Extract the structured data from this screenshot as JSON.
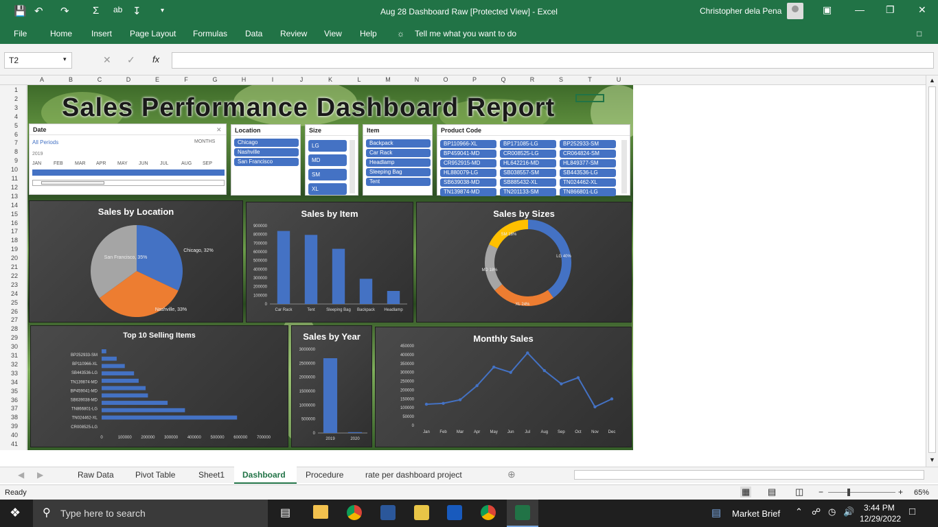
{
  "window": {
    "title": "Aug 28 Dashboard Raw  [Protected View]  -  Excel",
    "user": "Christopher dela Pena"
  },
  "ribbon": {
    "tabs": [
      "File",
      "Home",
      "Insert",
      "Page Layout",
      "Formulas",
      "Data",
      "Review",
      "View",
      "Help"
    ],
    "tell_me": "Tell me what you want to do"
  },
  "formula_bar": {
    "name_box": "T2",
    "fx": "fx",
    "formula": ""
  },
  "columns": [
    "A",
    "B",
    "C",
    "D",
    "E",
    "F",
    "G",
    "H",
    "I",
    "J",
    "K",
    "L",
    "M",
    "N",
    "O",
    "P",
    "Q",
    "R",
    "S",
    "T",
    "U"
  ],
  "rows": [
    "1",
    "2",
    "3",
    "4",
    "5",
    "6",
    "7",
    "8",
    "9",
    "10",
    "11",
    "12",
    "13",
    "14",
    "15",
    "16",
    "17",
    "18",
    "19",
    "20",
    "21",
    "22",
    "23",
    "24",
    "25",
    "26",
    "27",
    "28",
    "29",
    "30",
    "31",
    "32",
    "33",
    "34",
    "35",
    "36",
    "37",
    "38",
    "39",
    "40",
    "41"
  ],
  "dashboard": {
    "title": "Sales Performance Dashboard Report",
    "date_slicer": {
      "header": "Date",
      "all_periods": "All Periods",
      "granularity": "MONTHS",
      "year": "2019",
      "months": [
        "JAN",
        "FEB",
        "MAR",
        "APR",
        "MAY",
        "JUN",
        "JUL",
        "AUG",
        "SEP"
      ]
    },
    "location_slicer": {
      "header": "Location",
      "items": [
        "Chicago",
        "Nashville",
        "San Francisco"
      ]
    },
    "size_slicer": {
      "header": "Size",
      "items": [
        "LG",
        "MD",
        "SM",
        "XL"
      ]
    },
    "item_slicer": {
      "header": "Item",
      "items": [
        "Backpack",
        "Car Rack",
        "Headlamp",
        "Sleeping Bag",
        "Tent"
      ]
    },
    "product_slicer": {
      "header": "Product Code",
      "items": [
        "BP110966-XL",
        "BP171085-LG",
        "BP252933-SM",
        "BP459041-MD",
        "CR008525-LG",
        "CR064824-SM",
        "CR952915-MD",
        "HL642216-MD",
        "HL849377-SM",
        "HL880079-LG",
        "SB038557-SM",
        "SB443536-LG",
        "SB639038-MD",
        "SB885432-XL",
        "TN024462-XL",
        "TN139874-MD",
        "TN201133-SM",
        "TN866801-LG"
      ]
    }
  },
  "chart_data": [
    {
      "type": "pie",
      "title": "Sales by Location",
      "labels": [
        "Chicago, 32%",
        "Nashville, 33%",
        "San Francisco, 35%"
      ],
      "categories": [
        "Chicago",
        "Nashville",
        "San Francisco"
      ],
      "values": [
        32,
        33,
        35
      ],
      "colors": [
        "#4472c4",
        "#ed7d31",
        "#a5a5a5"
      ]
    },
    {
      "type": "bar",
      "title": "Sales by Item",
      "categories": [
        "Car Rack",
        "Tent",
        "Sleeping Bag",
        "Backpack",
        "Headlamp"
      ],
      "values": [
        840000,
        795000,
        635000,
        290000,
        150000
      ],
      "ylim": [
        0,
        900000
      ],
      "yticks": [
        "900000",
        "800000",
        "700000",
        "600000",
        "500000",
        "400000",
        "300000",
        "200000",
        "100000",
        "0"
      ]
    },
    {
      "type": "pie",
      "title": "Sales by Sizes",
      "categories": [
        "LG",
        "XL",
        "MD",
        "SM"
      ],
      "values": [
        40,
        24,
        18,
        18
      ],
      "labels": [
        "LG\n40%",
        "XL\n24%",
        "MD\n18%",
        "SM\n18%"
      ],
      "colors": [
        "#4472c4",
        "#ed7d31",
        "#a5a5a5",
        "#ffc000"
      ]
    },
    {
      "type": "bar",
      "title": "Top 10 Selling Items",
      "categories": [
        "BP252933-SM",
        "BP110966-XL",
        "SB443536-LG",
        "TN139874-MD",
        "BP459041-MD",
        "SB639038-MD",
        "TN866801-LG",
        "TN024462-XL",
        "CR008525-LG"
      ],
      "values": [
        20000,
        65000,
        100000,
        140000,
        160000,
        190000,
        200000,
        285000,
        360000,
        585000,
        0
      ],
      "ylim": [
        0,
        700000
      ],
      "xticks": [
        "0",
        "100000",
        "200000",
        "300000",
        "400000",
        "500000",
        "600000",
        "700000"
      ]
    },
    {
      "type": "bar",
      "title": "Sales by Year",
      "categories": [
        "2019",
        "2020"
      ],
      "values": [
        2680000,
        30000
      ],
      "ylim": [
        0,
        3000000
      ],
      "yticks": [
        "3000000",
        "2500000",
        "2000000",
        "1500000",
        "1000000",
        "500000",
        "0"
      ]
    },
    {
      "type": "line",
      "title": "Monthly Sales",
      "categories": [
        "Jan",
        "Feb",
        "Mar",
        "Apr",
        "May",
        "Jun",
        "Jul",
        "Aug",
        "Sep",
        "Oct",
        "Nov",
        "Dec"
      ],
      "values": [
        120000,
        125000,
        145000,
        225000,
        330000,
        300000,
        410000,
        310000,
        235000,
        270000,
        105000,
        150000
      ],
      "ylim": [
        0,
        450000
      ],
      "yticks": [
        "450000",
        "400000",
        "350000",
        "300000",
        "250000",
        "200000",
        "150000",
        "100000",
        "50000",
        "0"
      ]
    }
  ],
  "sheet_tabs": [
    "Raw Data",
    "Pivot Table",
    "Sheet1",
    "Dashboard",
    "Procedure",
    "rate per dashboard project"
  ],
  "active_tab": "Dashboard",
  "status": {
    "text": "Ready",
    "zoom": "65%"
  },
  "taskbar": {
    "search_placeholder": "Type here to search",
    "news": "Market Brief",
    "time": "3:44 PM",
    "date": "12/29/2022"
  },
  "colors": {
    "excel_green": "#217346",
    "accent_blue": "#4472c4",
    "orange": "#ed7d31",
    "gray": "#a5a5a5",
    "gold": "#ffc000"
  }
}
